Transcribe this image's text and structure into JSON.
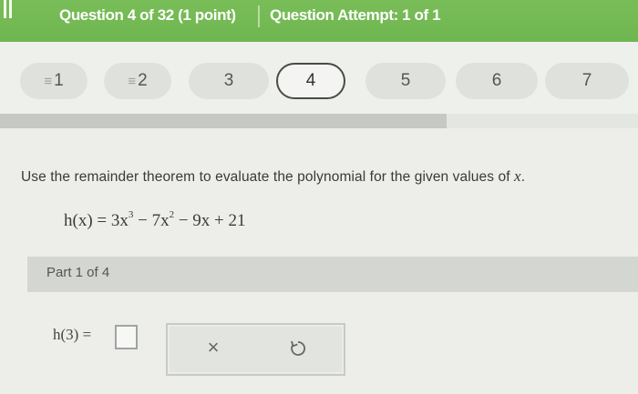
{
  "header": {
    "question_title": "Question 4 of 32 (1 point)",
    "attempt_text": "Question Attempt: 1 of 1"
  },
  "nav": {
    "pills": [
      {
        "label": "1",
        "state": "answered"
      },
      {
        "label": "2",
        "state": "answered"
      },
      {
        "label": "3",
        "state": "unanswered"
      },
      {
        "label": "4",
        "state": "current"
      },
      {
        "label": "5",
        "state": "unanswered"
      },
      {
        "label": "6",
        "state": "unanswered"
      },
      {
        "label": "7",
        "state": "unanswered"
      }
    ],
    "answered_icon": "≡",
    "progress_fraction": 0.7
  },
  "question": {
    "instruction_prefix": "Use the remainder theorem to evaluate the polynomial for the given values of",
    "instruction_var": "x",
    "instruction_suffix": ".",
    "equation_lhs": "h(x) = 3x",
    "eq_exp1": "3",
    "eq_mid": " − 7x",
    "eq_exp2": "2",
    "eq_tail": " − 9x + 21"
  },
  "part": {
    "label": "Part 1 of 4",
    "answer_label": "h(3) =",
    "answer_value": ""
  },
  "tools": {
    "clear_icon": "×",
    "undo_icon": "undo-icon"
  },
  "colors": {
    "header_green": "#74ba54",
    "background": "#edeee9"
  }
}
